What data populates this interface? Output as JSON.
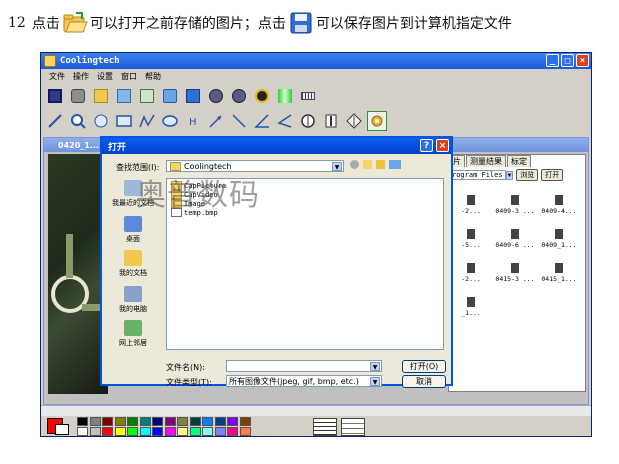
{
  "caption": {
    "number": "12",
    "part1": "点击",
    "part2": "可以打开之前存储的图片；点击",
    "part3": "可以保存图片到计算机指定文件"
  },
  "app": {
    "title": "Coolingtech",
    "menu": [
      "文件",
      "操作",
      "设置",
      "窗口",
      "帮助"
    ],
    "toolbar1_icons": [
      "stop-icon",
      "camera-icon",
      "open-folder-icon",
      "image-icon",
      "table-icon",
      "switch-icon",
      "save-icon",
      "pause-icon",
      "record-icon",
      "magnifier-icon",
      "color-bars-icon",
      "ruler-icon"
    ],
    "toolbar2_icons": [
      "line-icon",
      "zoom-icon",
      "pan-icon",
      "rectangle-icon",
      "polyline-icon",
      "ellipse-icon",
      "text-h-icon",
      "arrow-icon",
      "arrow-pair-icon",
      "angle-icon",
      "angle-arc-icon",
      "circle-measure-icon",
      "height-icon",
      "diameter-icon",
      "settings-icon"
    ]
  },
  "child_window": {
    "title": "0420_1..."
  },
  "right_panel": {
    "tabs": [
      "片",
      "测量结果",
      "标定"
    ],
    "path": "rogram Files",
    "browse_label": "浏览",
    "open_label": "打开",
    "thumbnails": [
      "-2...",
      "0409-3 ...",
      "0409-4...",
      "-5...",
      "0409-6 ...",
      "0409_1...",
      "-2...",
      "0415-3 ...",
      "0415_1...",
      "_1..."
    ]
  },
  "dialog": {
    "title": "打开",
    "look_in_label": "查找范围(I):",
    "look_in_value": "Coolingtech",
    "places": [
      "我最近的文档",
      "桌面",
      "我的文档",
      "我的电脑",
      "网上邻居"
    ],
    "files": [
      {
        "name": "CapPicture",
        "type": "folder"
      },
      {
        "name": "CapVideo",
        "type": "folder"
      },
      {
        "name": "Image",
        "type": "folder"
      },
      {
        "name": "temp.bmp",
        "type": "image"
      }
    ],
    "filename_label": "文件名(N):",
    "filename_value": "",
    "filetype_label": "文件类型(T):",
    "filetype_value": "所有图像文件(jpeg, gif, bmp, etc.)",
    "open_button": "打开(O)",
    "cancel_button": "取消"
  },
  "watermark": "奥普数码",
  "palette_colors": [
    "#000000",
    "#808080",
    "#800000",
    "#808000",
    "#008000",
    "#008080",
    "#000080",
    "#800080",
    "#808040",
    "#004040",
    "#0080ff",
    "#004080",
    "#8000ff",
    "#804000",
    "#ffffff",
    "#c0c0c0",
    "#ff0000",
    "#ffff00",
    "#00ff00",
    "#00ffff",
    "#0000ff",
    "#ff00ff",
    "#ffff80",
    "#00ff80",
    "#80ffff",
    "#8080ff",
    "#ff0080",
    "#ff8040"
  ]
}
